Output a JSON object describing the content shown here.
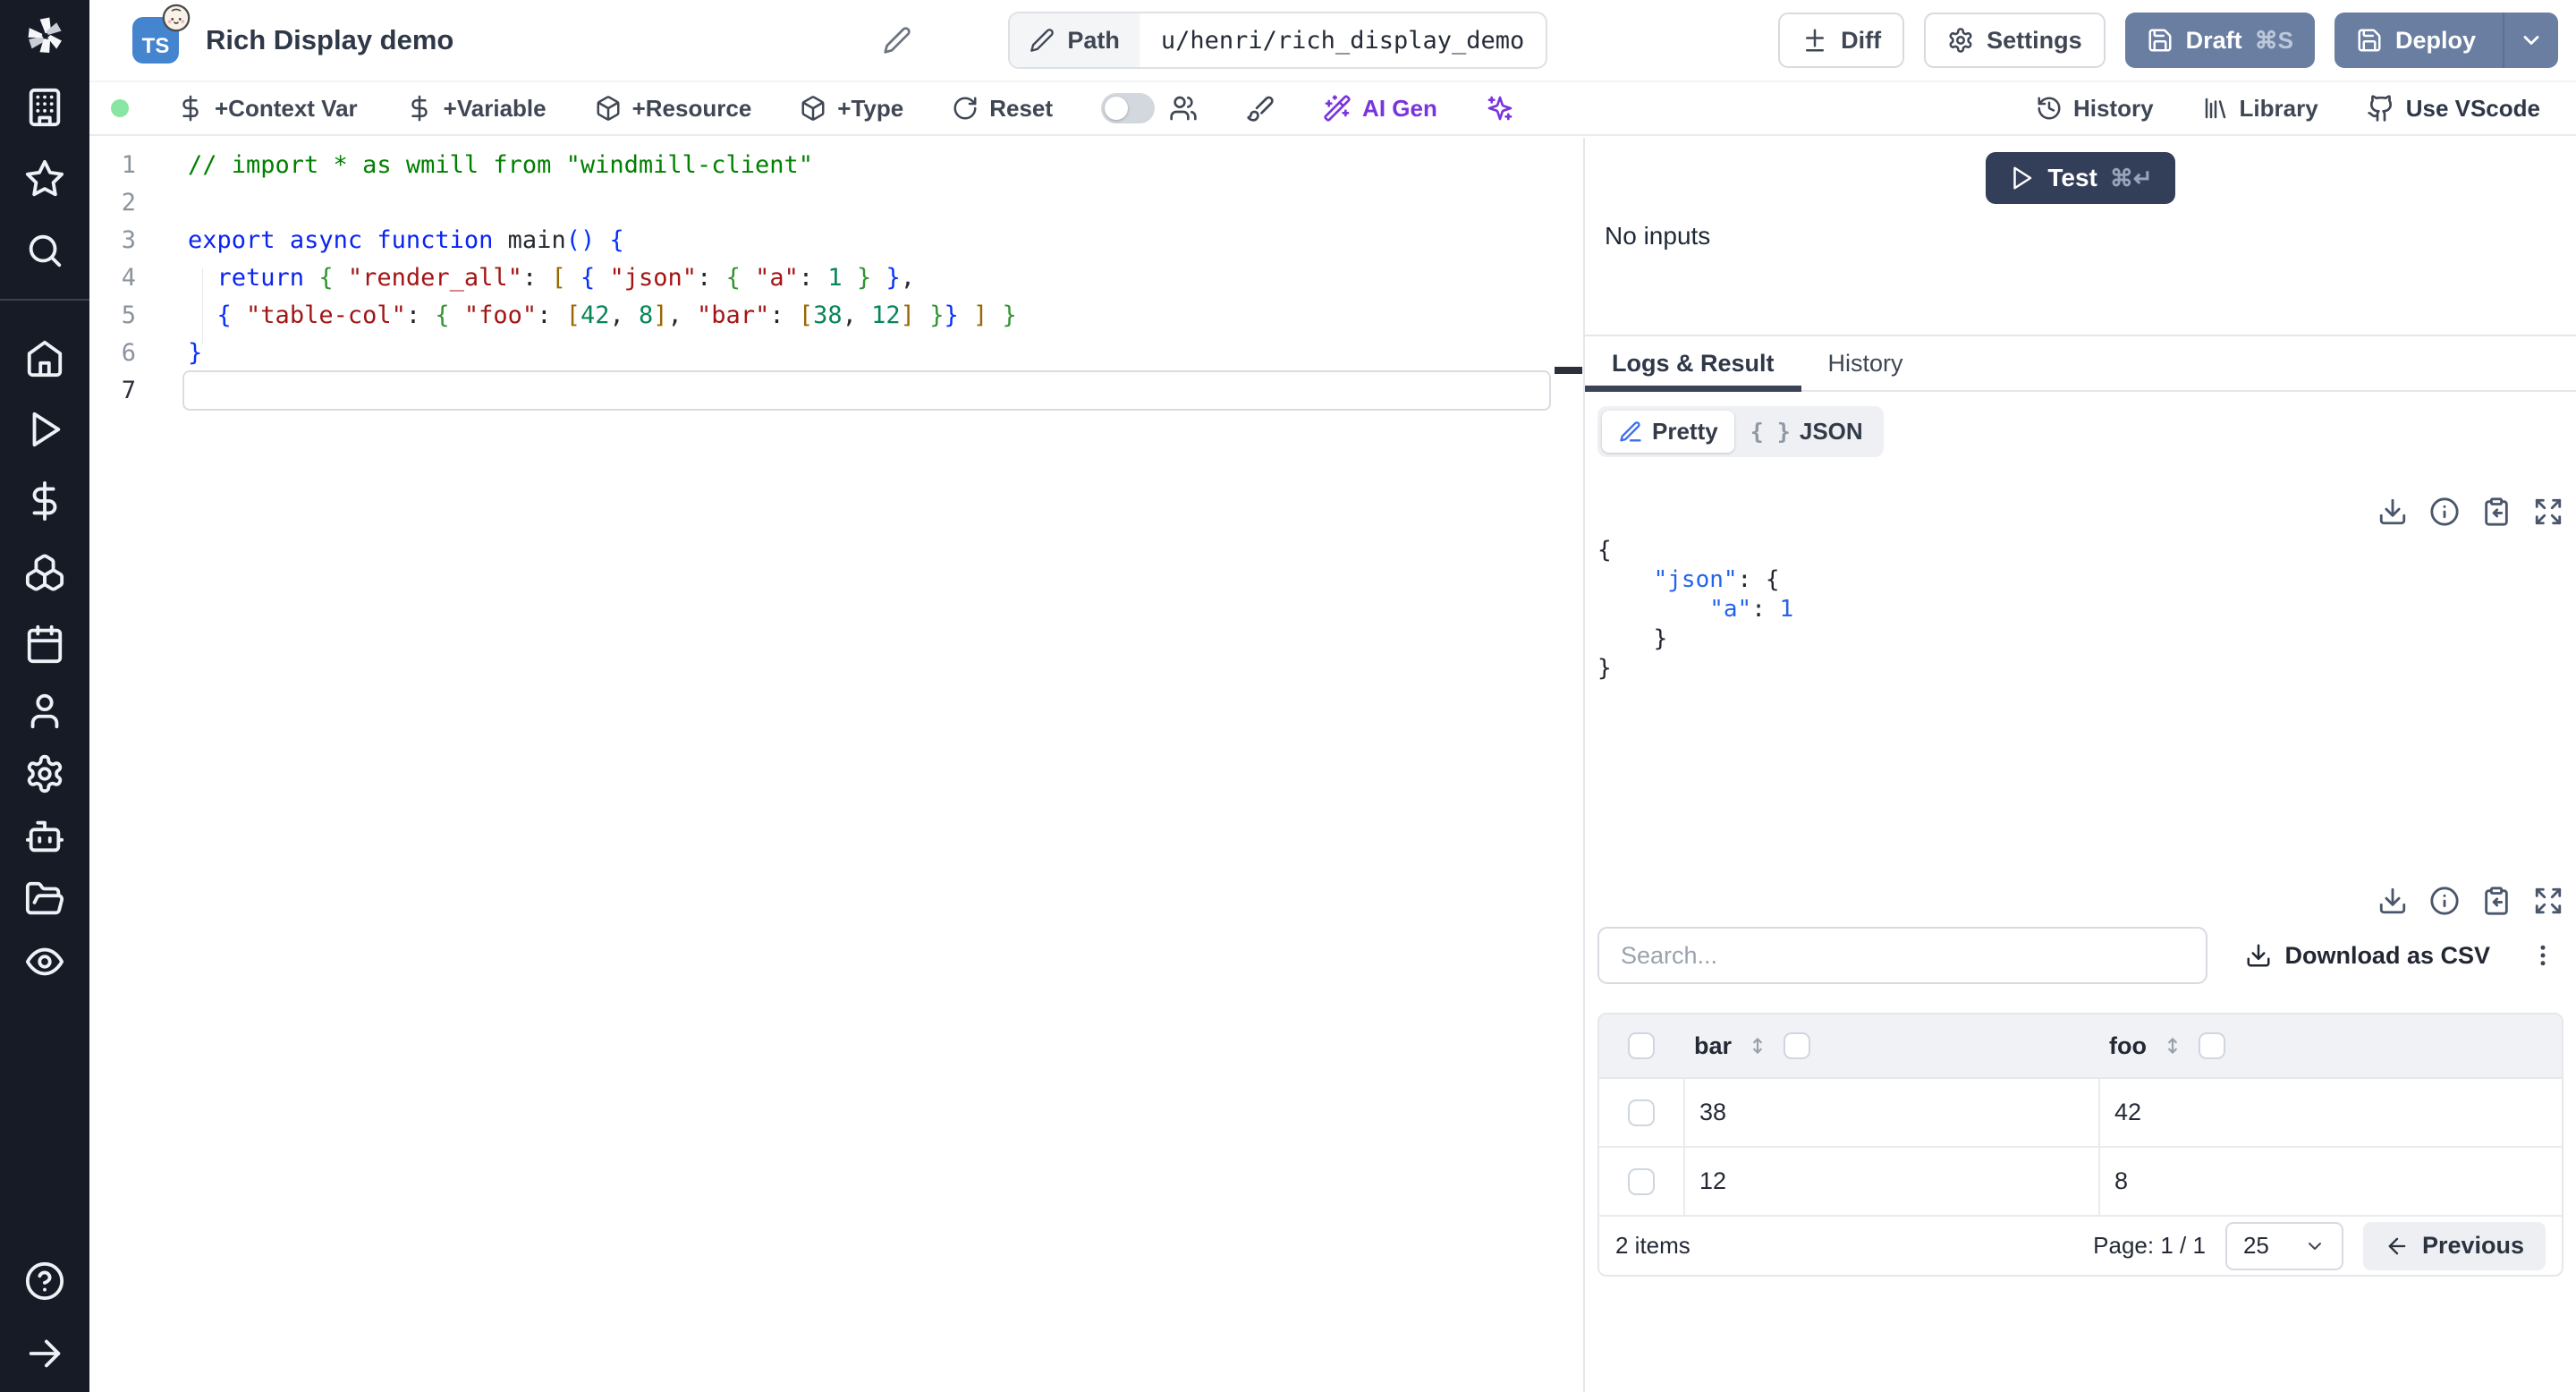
{
  "header": {
    "ts_badge": "TS",
    "title": "Rich Display demo",
    "path_label": "Path",
    "path_value": "u/henri/rich_display_demo",
    "diff_label": "Diff",
    "settings_label": "Settings",
    "draft_label": "Draft",
    "draft_shortcut": "⌘S",
    "deploy_label": "Deploy"
  },
  "toolbar": {
    "context_var": "+Context Var",
    "variable": "+Variable",
    "resource": "+Resource",
    "type": "+Type",
    "reset": "Reset",
    "ai_gen": "AI Gen",
    "history": "History",
    "library": "Library",
    "vscode": "Use VScode"
  },
  "editor": {
    "language": "typescript",
    "lines": [
      [
        {
          "t": "// import * as wmill from \"windmill-client\"",
          "c": "comment"
        }
      ],
      [],
      [
        {
          "t": "export",
          "c": "kw"
        },
        {
          "t": " ",
          "c": "plain"
        },
        {
          "t": "async",
          "c": "kw"
        },
        {
          "t": " ",
          "c": "plain"
        },
        {
          "t": "function",
          "c": "kw"
        },
        {
          "t": " ",
          "c": "plain"
        },
        {
          "t": "main",
          "c": "fn"
        },
        {
          "t": "()",
          "c": "b1"
        },
        {
          "t": " ",
          "c": "plain"
        },
        {
          "t": "{",
          "c": "b1"
        }
      ],
      [
        {
          "t": "  ",
          "c": "plain"
        },
        {
          "t": "return",
          "c": "kw"
        },
        {
          "t": " ",
          "c": "plain"
        },
        {
          "t": "{",
          "c": "b2"
        },
        {
          "t": " ",
          "c": "plain"
        },
        {
          "t": "\"render_all\"",
          "c": "str"
        },
        {
          "t": ": ",
          "c": "plain"
        },
        {
          "t": "[",
          "c": "b3"
        },
        {
          "t": " ",
          "c": "plain"
        },
        {
          "t": "{",
          "c": "b1"
        },
        {
          "t": " ",
          "c": "plain"
        },
        {
          "t": "\"json\"",
          "c": "str"
        },
        {
          "t": ": ",
          "c": "plain"
        },
        {
          "t": "{",
          "c": "b2"
        },
        {
          "t": " ",
          "c": "plain"
        },
        {
          "t": "\"a\"",
          "c": "str"
        },
        {
          "t": ": ",
          "c": "plain"
        },
        {
          "t": "1",
          "c": "num"
        },
        {
          "t": " ",
          "c": "plain"
        },
        {
          "t": "}",
          "c": "b2"
        },
        {
          "t": " ",
          "c": "plain"
        },
        {
          "t": "}",
          "c": "b1"
        },
        {
          "t": ",",
          "c": "plain"
        }
      ],
      [
        {
          "t": "  ",
          "c": "plain"
        },
        {
          "t": "{",
          "c": "b1"
        },
        {
          "t": " ",
          "c": "plain"
        },
        {
          "t": "\"table-col\"",
          "c": "str"
        },
        {
          "t": ": ",
          "c": "plain"
        },
        {
          "t": "{",
          "c": "b2"
        },
        {
          "t": " ",
          "c": "plain"
        },
        {
          "t": "\"foo\"",
          "c": "str"
        },
        {
          "t": ": ",
          "c": "plain"
        },
        {
          "t": "[",
          "c": "b3"
        },
        {
          "t": "42",
          "c": "num"
        },
        {
          "t": ", ",
          "c": "plain"
        },
        {
          "t": "8",
          "c": "num"
        },
        {
          "t": "]",
          "c": "b3"
        },
        {
          "t": ", ",
          "c": "plain"
        },
        {
          "t": "\"bar\"",
          "c": "str"
        },
        {
          "t": ": ",
          "c": "plain"
        },
        {
          "t": "[",
          "c": "b3"
        },
        {
          "t": "38",
          "c": "num"
        },
        {
          "t": ", ",
          "c": "plain"
        },
        {
          "t": "12",
          "c": "num"
        },
        {
          "t": "]",
          "c": "b3"
        },
        {
          "t": " ",
          "c": "plain"
        },
        {
          "t": "}",
          "c": "b2"
        },
        {
          "t": "}",
          "c": "b1"
        },
        {
          "t": " ",
          "c": "plain"
        },
        {
          "t": "]",
          "c": "b3"
        },
        {
          "t": " ",
          "c": "plain"
        },
        {
          "t": "}",
          "c": "b2"
        }
      ],
      [
        {
          "t": "}",
          "c": "b1"
        }
      ],
      []
    ]
  },
  "run": {
    "test_label": "Test",
    "test_shortcut": "⌘↵",
    "no_inputs": "No inputs"
  },
  "result": {
    "tabs": [
      "Logs & Result",
      "History"
    ],
    "view_pretty": "Pretty",
    "view_json": "JSON",
    "json_braces": "{ }",
    "json_lines": [
      [
        {
          "t": "{",
          "c": "p"
        }
      ],
      [
        {
          "t": "    ",
          "c": "p"
        },
        {
          "t": "\"json\"",
          "c": "k"
        },
        {
          "t": ": ",
          "c": "p"
        },
        {
          "t": "{",
          "c": "p"
        }
      ],
      [
        {
          "t": "        ",
          "c": "p"
        },
        {
          "t": "\"a\"",
          "c": "k"
        },
        {
          "t": ": ",
          "c": "p"
        },
        {
          "t": "1",
          "c": "v"
        }
      ],
      [
        {
          "t": "    ",
          "c": "p"
        },
        {
          "t": "}",
          "c": "p"
        }
      ],
      [
        {
          "t": "}",
          "c": "p"
        }
      ]
    ]
  },
  "table": {
    "search_placeholder": "Search...",
    "download_csv": "Download as CSV",
    "columns": [
      "bar",
      "foo"
    ],
    "rows": [
      [
        "38",
        "42"
      ],
      [
        "12",
        "8"
      ]
    ],
    "items_count": "2 items",
    "page": "Page: 1 / 1",
    "page_size": "25",
    "previous": "Previous"
  },
  "icons": {
    "sidebar": [
      "windmill-logo",
      "building",
      "star",
      "search",
      "home",
      "play",
      "dollar",
      "boxes",
      "calendar",
      "user",
      "settings",
      "bot",
      "folder-open",
      "eye",
      "help-circle",
      "arrow-right"
    ],
    "header": [
      "pencil",
      "diff",
      "gear",
      "save",
      "chevron-down"
    ],
    "toolbar": [
      "dollar",
      "package",
      "rotate-cw",
      "toggle",
      "users",
      "brush",
      "wand",
      "sparkles",
      "history",
      "library",
      "github"
    ],
    "result": [
      "play",
      "pen",
      "braces",
      "download",
      "info",
      "clipboard-copy",
      "expand",
      "ellipsis-vertical",
      "sort-vertical",
      "arrow-left"
    ]
  },
  "colors": {
    "sidebar_bg": "#171b26",
    "deploy_blue": "#6a7ea1",
    "test_navy": "#333e59",
    "ai_purple": "#7a34dd",
    "status_green": "#88e5a3",
    "json_blue": "#2563eb",
    "ts_blue": "#4584cf",
    "tab_underline": "#3b4356"
  }
}
